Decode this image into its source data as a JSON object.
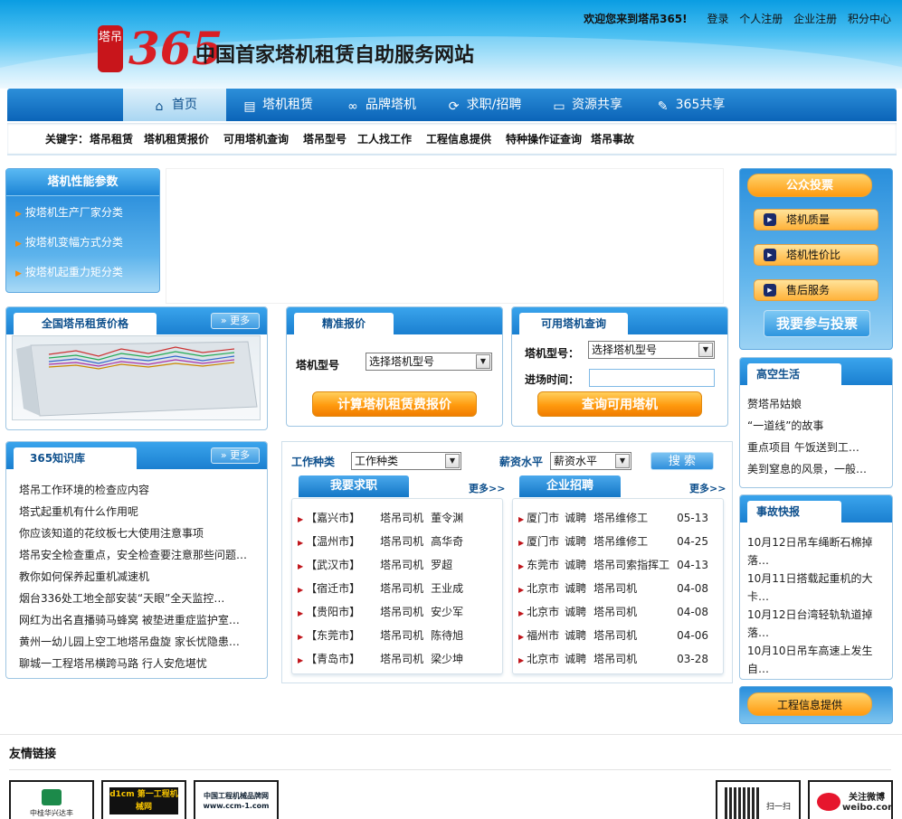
{
  "header": {
    "logo_seal": "塔吊",
    "logo_number": "365",
    "slogan": "中国首家塔机租赁自助服务网站",
    "welcome": "欢迎您来到塔吊365!",
    "links": [
      "登录",
      "个人注册",
      "企业注册",
      "积分中心"
    ]
  },
  "nav": {
    "items": [
      {
        "label": "首页",
        "icon": "home-icon",
        "glyph": "⌂"
      },
      {
        "label": "塔机租赁",
        "icon": "document-icon",
        "glyph": "▤"
      },
      {
        "label": "品牌塔机",
        "icon": "link-icon",
        "glyph": "∞"
      },
      {
        "label": "求职/招聘",
        "icon": "refresh-icon",
        "glyph": "⟳"
      },
      {
        "label": "资源共享",
        "icon": "monitor-icon",
        "glyph": "▭"
      },
      {
        "label": "365共享",
        "icon": "share-icon",
        "glyph": "✎"
      }
    ]
  },
  "keywords": {
    "label": "关键字：",
    "items": [
      "塔吊租赁",
      "塔机租赁报价",
      "可用塔机查询",
      "塔吊型号",
      "工人找工作",
      "工程信息提供",
      "特种操作证查询",
      "塔吊事故"
    ]
  },
  "perf": {
    "title": "塔机性能参数",
    "items": [
      "按塔机生产厂家分类",
      "按塔机变幅方式分类",
      "按塔机起重力矩分类"
    ]
  },
  "price_box": {
    "title": "全国塔吊租赁价格",
    "more": "更多"
  },
  "quote_box": {
    "title": "精准报价",
    "model_label": "塔机型号",
    "model_value": "选择塔机型号",
    "button": "计算塔机租赁费报价"
  },
  "available_box": {
    "title": "可用塔机查询",
    "model_label": "塔机型号：",
    "model_value": "选择塔机型号",
    "time_label": "进场时间：",
    "time_value": "",
    "button": "查询可用塔机"
  },
  "knowledge": {
    "title": "365知识库",
    "more": "更多",
    "items": [
      "塔吊工作环境的检查应内容",
      "塔式起重机有什么作用呢",
      "你应该知道的花纹板七大使用注意事项",
      "塔吊安全检查重点，安全检查要注意那些问题…",
      "教你如何保养起重机减速机",
      "烟台336处工地全部安装“天眼”全天监控…",
      "网红为出名直播骑马蜂窝 被垫进重症监护室…",
      "黄州一幼儿园上空工地塔吊盘旋 家长忧隐患…",
      "聊城一工程塔吊横跨马路 行人安危堪忧"
    ]
  },
  "jobs": {
    "type_label": "工作种类",
    "type_value": "工作种类",
    "salary_label": "薪资水平",
    "salary_value": "薪资水平",
    "search": "搜 索",
    "seek_title": "我要求职",
    "seek_more": "更多>>",
    "hire_title": "企业招聘",
    "hire_more": "更多>>",
    "seek": [
      {
        "city": "【嘉兴市】",
        "job": "塔吊司机",
        "name": "董令渊"
      },
      {
        "city": "【温州市】",
        "job": "塔吊司机",
        "name": "高华奇"
      },
      {
        "city": "【武汉市】",
        "job": "塔吊司机",
        "name": "罗超"
      },
      {
        "city": "【宿迁市】",
        "job": "塔吊司机",
        "name": "王业成"
      },
      {
        "city": "【贵阳市】",
        "job": "塔吊司机",
        "name": "安少军"
      },
      {
        "city": "【东莞市】",
        "job": "塔吊司机",
        "name": "陈待旭"
      },
      {
        "city": "【青岛市】",
        "job": "塔吊司机",
        "name": "梁少坤"
      }
    ],
    "hire": [
      {
        "city": "厦门市",
        "act": "诚聘",
        "job": "塔吊维修工",
        "date": "05-13"
      },
      {
        "city": "厦门市",
        "act": "诚聘",
        "job": "塔吊维修工",
        "date": "04-25"
      },
      {
        "city": "东莞市",
        "act": "诚聘",
        "job": "塔吊司索指挥工",
        "date": "04-13"
      },
      {
        "city": "北京市",
        "act": "诚聘",
        "job": "塔吊司机",
        "date": "04-08"
      },
      {
        "city": "北京市",
        "act": "诚聘",
        "job": "塔吊司机",
        "date": "04-08"
      },
      {
        "city": "福州市",
        "act": "诚聘",
        "job": "塔吊司机",
        "date": "04-06"
      },
      {
        "city": "北京市",
        "act": "诚聘",
        "job": "塔吊司机",
        "date": "03-28"
      }
    ]
  },
  "vote": {
    "title": "公众投票",
    "items": [
      "塔机质量",
      "塔机性价比",
      "售后服务"
    ],
    "button": "我要参与投票"
  },
  "highlife": {
    "title": "高空生活",
    "items": [
      "赘塔吊姑娘",
      "“一道线”的故事",
      "重点项目 午饭送到工…",
      "美到窒息的风景，一般…"
    ]
  },
  "accidents": {
    "title": "事故快报",
    "items": [
      [
        "10月12日吊车绳断石棉掉",
        "落…"
      ],
      [
        "10月11日搭载起重机的大",
        "卡…"
      ],
      [
        "10月12日台湾轻轨轨道掉",
        "落…"
      ],
      [
        "10月10日吊车高速上发生",
        "自…"
      ]
    ]
  },
  "info_button": "工程信息提供",
  "friends": {
    "title": "友情链接",
    "logos": [
      {
        "text": "中桂华兴达丰",
        "icon": "tat-hong-logo"
      },
      {
        "text": "d1cm 第一工程机械网",
        "icon": "d1cm-logo"
      },
      {
        "text": "中国工程机械品牌网 www.ccm-1.com",
        "icon": "ccm1-logo"
      },
      {
        "text": "扫一扫",
        "icon": "qr-code-icon"
      },
      {
        "text": "关注微博 weibo.com",
        "icon": "weibo-icon"
      }
    ]
  }
}
